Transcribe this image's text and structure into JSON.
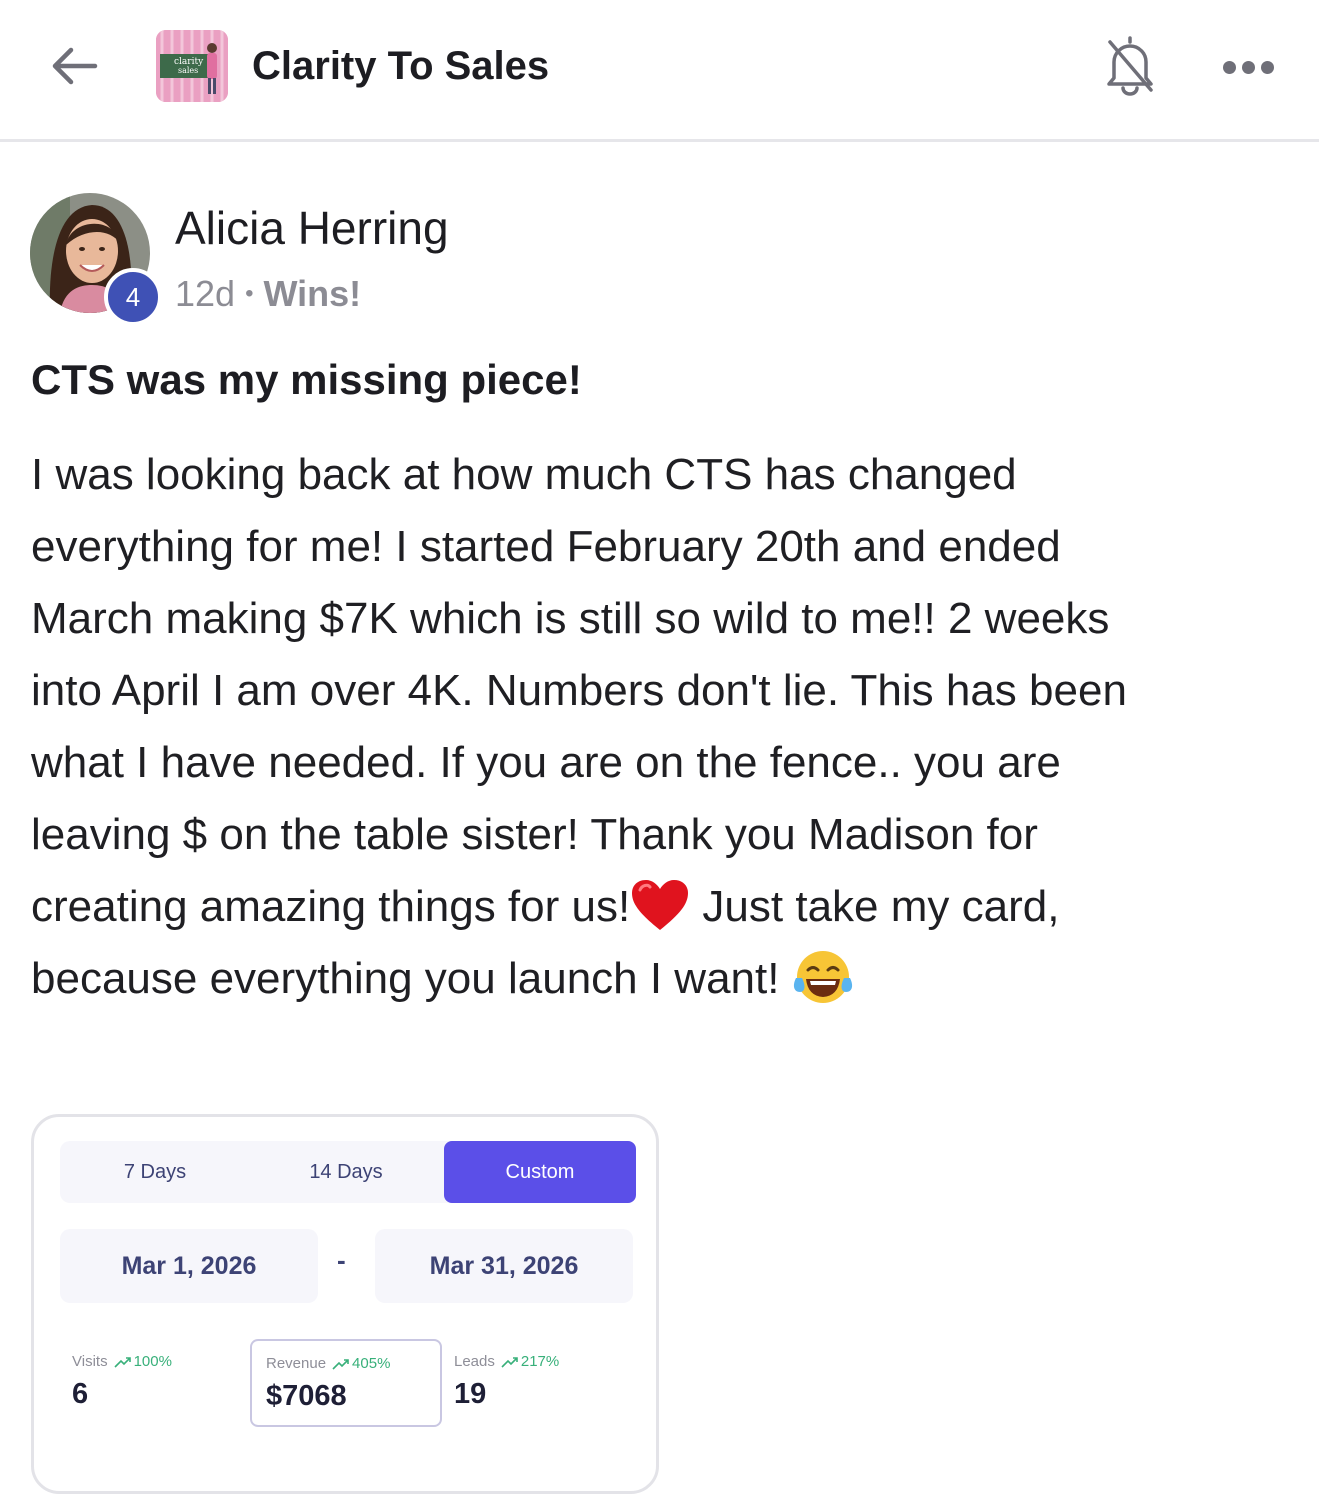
{
  "header": {
    "back_icon": "arrow-left-icon",
    "group_logo_text": "clarity to sales",
    "group_name": "Clarity To Sales",
    "bell_icon": "bell-off-icon",
    "more_icon": "more-horizontal-icon"
  },
  "post": {
    "author": {
      "name": "Alicia Herring",
      "level": "4"
    },
    "meta": {
      "age": "12d",
      "separator": "•",
      "category": "Wins!"
    },
    "title": "CTS was my missing piece!",
    "body_lines": [
      "I was looking back at how much CTS has changed",
      "everything for me! I started February 20th and ended",
      "March making $7K which is still so wild to me!! 2 weeks",
      "into April I am over 4K. Numbers don't lie. This has been",
      "what I have needed. If you are on the fence.. you are",
      "leaving $ on the table sister! Thank you Madison for",
      "creating amazing things for us!",
      " Just take my card,",
      "because everything you launch I want! "
    ],
    "emojis": [
      "red-heart-emoji",
      "tears-of-joy-emoji"
    ]
  },
  "attachment": {
    "tabs": [
      "7 Days",
      "14 Days",
      "Custom"
    ],
    "active_tab": "Custom",
    "start_date": "Mar 1, 2026",
    "date_separator": "-",
    "end_date": "Mar 31, 2026",
    "stats": [
      {
        "label": "Visits",
        "change": "100%",
        "value": "6"
      },
      {
        "label": "Revenue",
        "change": "405%",
        "value": "$7068"
      },
      {
        "label": "Leads",
        "change": "217%",
        "value": "19"
      }
    ],
    "colors": {
      "accent": "#5b4fe8",
      "positive": "#38b07a",
      "text": "#3d4375"
    }
  }
}
